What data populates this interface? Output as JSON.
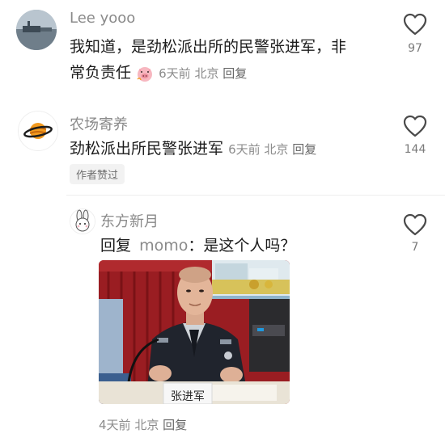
{
  "comments": [
    {
      "author": "Lee yooo",
      "text_line1": "我知道，是劲松派出所的民警张进军，非",
      "text_line2": "常负责任",
      "emoji": "pig-face-emoji",
      "time": "6天前",
      "location": "北京",
      "reply_label": "回复",
      "likes": "97"
    },
    {
      "author": "农场寄养",
      "text": "劲松派出所民警张进军",
      "time": "6天前",
      "location": "北京",
      "reply_label": "回复",
      "badge": "作者赞过",
      "likes": "144"
    },
    {
      "author": "东方新月",
      "reply_prefix": "回复",
      "reply_to": "momo",
      "text": "：是这个人吗？",
      "photo_nameplate": "张进军",
      "time": "4天前",
      "location": "北京",
      "reply_label": "回复",
      "likes": "7"
    }
  ],
  "colors": {
    "accent_text": "#8a8a8a",
    "like_icon": "#4a4a4a"
  },
  "icons": [
    "like-heart-icon",
    "planet-avatar-icon",
    "rabbit-avatar-icon"
  ]
}
